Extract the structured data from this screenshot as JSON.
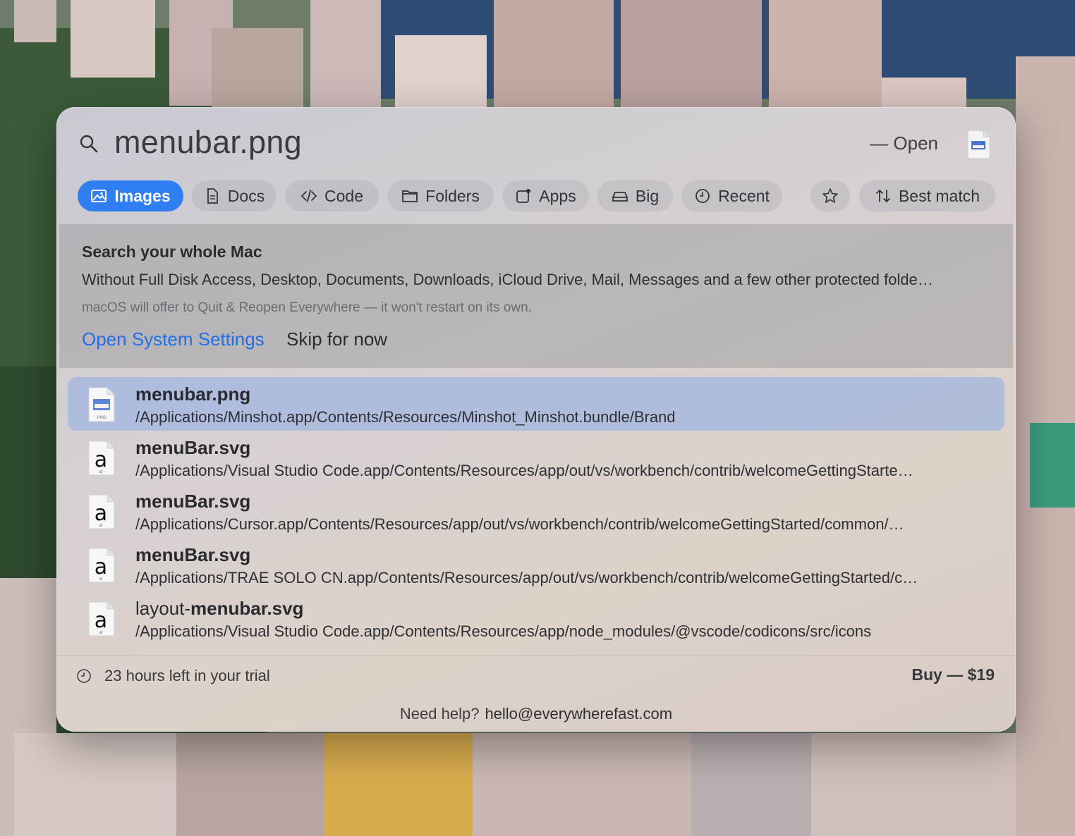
{
  "search": {
    "query": "menubar.png",
    "open_hint": "— Open"
  },
  "filters": [
    {
      "label": "Images",
      "icon": "image-icon",
      "active": true
    },
    {
      "label": "Docs",
      "icon": "doc-icon",
      "active": false
    },
    {
      "label": "Code",
      "icon": "code-icon",
      "active": false
    },
    {
      "label": "Folders",
      "icon": "folder-icon",
      "active": false
    },
    {
      "label": "Apps",
      "icon": "app-icon",
      "active": false
    },
    {
      "label": "Big",
      "icon": "drive-icon",
      "active": false
    },
    {
      "label": "Recent",
      "icon": "clock-icon",
      "active": false
    },
    {
      "label": "",
      "icon": "star-icon",
      "active": false
    },
    {
      "label": "Best match",
      "icon": "sort-icon",
      "active": false
    }
  ],
  "notice": {
    "title": "Search your whole Mac",
    "body": "Without Full Disk Access, Desktop, Documents, Downloads, iCloud Drive, Mail, Messages and a few other protected folde…",
    "sub": "macOS will offer to Quit & Reopen Everywhere — it won't restart on its own.",
    "primary_action": "Open System Settings",
    "secondary_action": "Skip for now"
  },
  "results": [
    {
      "name_prefix": "",
      "name_bold": "menubar.png",
      "path": "/Applications/Minshot.app/Contents/Resources/Minshot_Minshot.bundle/Brand",
      "icon": "png-file-icon",
      "icon_badge": "PNG",
      "selected": true
    },
    {
      "name_prefix": "",
      "name_bold": "menuBar.svg",
      "path": "/Applications/Visual Studio Code.app/Contents/Resources/app/out/vs/workbench/contrib/welcomeGettingStarte…",
      "icon": "font-file-icon",
      "icon_badge": "af",
      "selected": false
    },
    {
      "name_prefix": "",
      "name_bold": "menuBar.svg",
      "path": "/Applications/Cursor.app/Contents/Resources/app/out/vs/workbench/contrib/welcomeGettingStarted/common/…",
      "icon": "font-file-icon",
      "icon_badge": "af",
      "selected": false
    },
    {
      "name_prefix": "",
      "name_bold": "menuBar.svg",
      "path": "/Applications/TRAE SOLO CN.app/Contents/Resources/app/out/vs/workbench/contrib/welcomeGettingStarted/c…",
      "icon": "font-file-icon",
      "icon_badge": "af",
      "selected": false
    },
    {
      "name_prefix": "layout-",
      "name_bold": "menubar.svg",
      "path": "/Applications/Visual Studio Code.app/Contents/Resources/app/node_modules/@vscode/codicons/src/icons",
      "icon": "font-file-icon",
      "icon_badge": "af",
      "selected": false
    }
  ],
  "footer": {
    "trial_text": "23 hours left in your trial",
    "buy_label": "Buy — $19",
    "help_label": "Need help?",
    "help_email": "hello@everywherefast.com"
  },
  "colors": {
    "accent": "#2f7ff2",
    "link": "#1f6fe8",
    "selection": "#b4c2e4"
  }
}
